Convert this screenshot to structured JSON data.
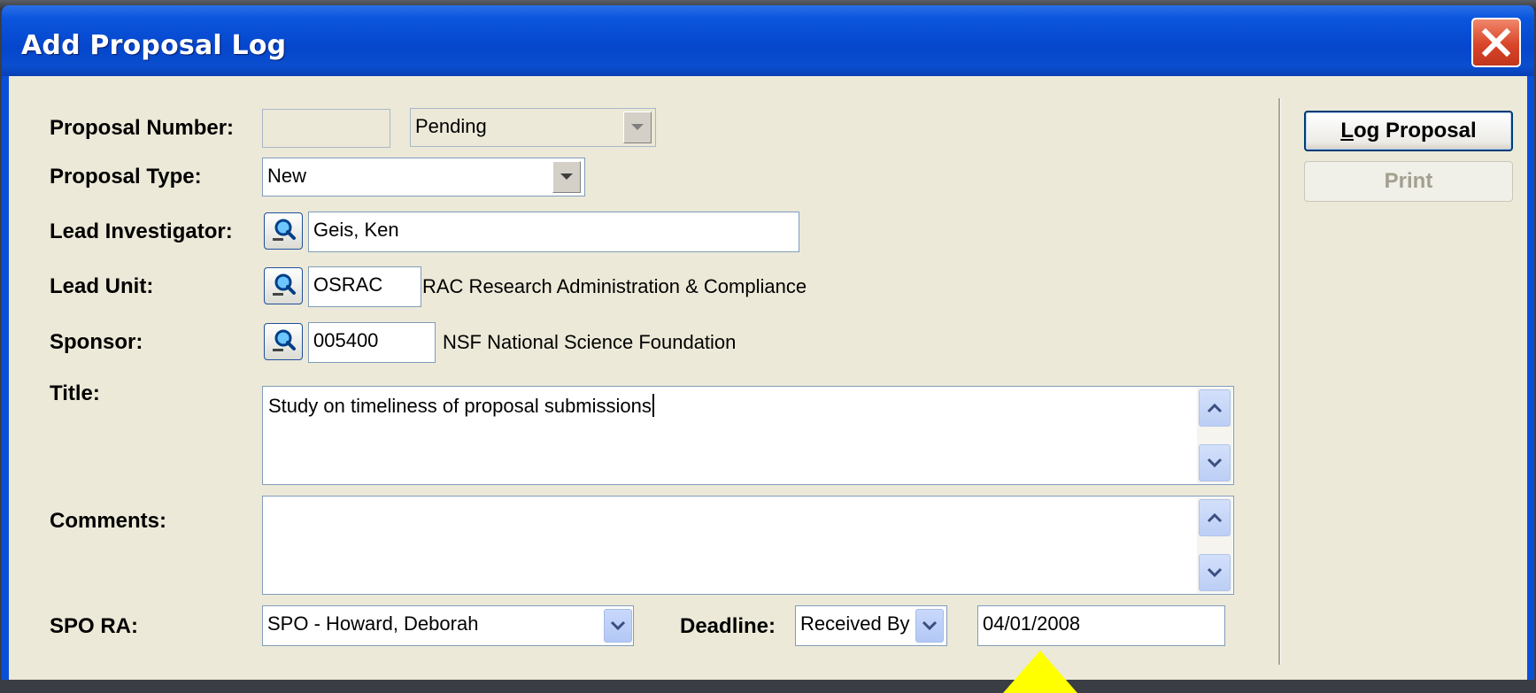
{
  "window": {
    "title": "Add Proposal Log"
  },
  "form": {
    "proposal_number": {
      "label": "Proposal Number:",
      "value": "",
      "status": "Pending"
    },
    "proposal_type": {
      "label": "Proposal Type:",
      "value": "New"
    },
    "lead_investigator": {
      "label": "Lead Investigator:",
      "value": "Geis, Ken"
    },
    "lead_unit": {
      "label": "Lead Unit:",
      "code": "OSRAC",
      "name": "RAC Research Administration & Compliance"
    },
    "sponsor": {
      "label": "Sponsor:",
      "code": "005400",
      "name": "NSF National Science Foundation"
    },
    "title": {
      "label": "Title:",
      "value": "Study on timeliness of proposal submissions"
    },
    "comments": {
      "label": "Comments:",
      "value": ""
    },
    "spo_ra": {
      "label": "SPO RA:",
      "value": "SPO - Howard, Deborah"
    },
    "deadline": {
      "label": "Deadline:",
      "type": "Received By",
      "date": "04/01/2008"
    }
  },
  "buttons": {
    "log_proposal": "Log Proposal",
    "print": "Print"
  },
  "icons": {
    "lookup": "magnifier-lookup-icon",
    "dropdown": "chevron-down-icon",
    "scroll_up": "chevron-up-icon",
    "scroll_down": "chevron-down-icon",
    "close": "close-x-icon"
  },
  "colors": {
    "titlebar": "#0546cc",
    "client_bg": "#ece9d8",
    "close_button": "#d8452a",
    "annotation_arrow": "#ffff00"
  }
}
